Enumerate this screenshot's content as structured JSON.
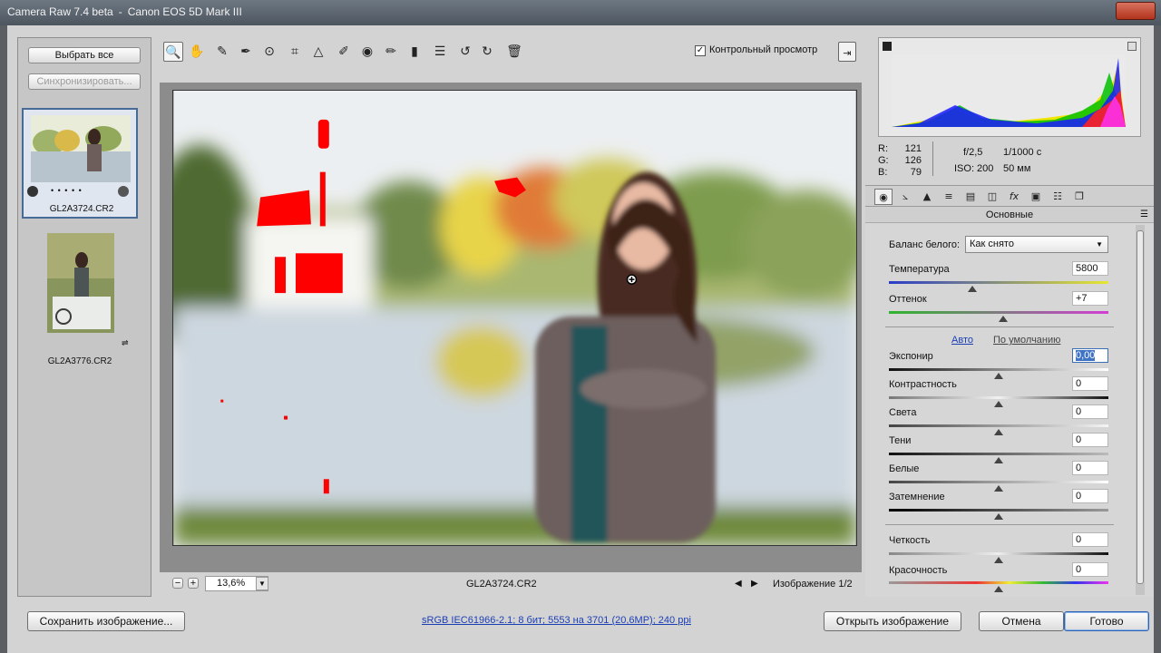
{
  "window": {
    "app": "Camera Raw 7.4 beta",
    "separator": "-",
    "camera": "Canon EOS 5D Mark III"
  },
  "filmstrip": {
    "select_all": "Выбрать все",
    "synchronize": "Синхронизировать...",
    "rating_dots": "• • • • •",
    "items": [
      {
        "name": "GL2A3724.CR2",
        "selected": true
      },
      {
        "name": "GL2A3776.CR2",
        "selected": false
      }
    ]
  },
  "toolbar": {
    "tools": [
      {
        "icon": "zoom-icon",
        "glyph": "🔍"
      },
      {
        "icon": "hand-icon",
        "glyph": "✋"
      },
      {
        "icon": "white-balance-icon",
        "glyph": "✎"
      },
      {
        "icon": "color-sampler-icon",
        "glyph": "✒"
      },
      {
        "icon": "target-adjust-icon",
        "glyph": "⊙"
      },
      {
        "icon": "crop-icon",
        "glyph": "⌗"
      },
      {
        "icon": "straighten-icon",
        "glyph": "△"
      },
      {
        "icon": "spot-removal-icon",
        "glyph": "✐"
      },
      {
        "icon": "red-eye-icon",
        "glyph": "◉"
      },
      {
        "icon": "adjustment-brush-icon",
        "glyph": "✏"
      },
      {
        "icon": "graduated-filter-icon",
        "glyph": "▮"
      },
      {
        "icon": "preferences-icon",
        "glyph": "☰"
      },
      {
        "icon": "rotate-left-icon",
        "glyph": "↺"
      },
      {
        "icon": "rotate-right-icon",
        "glyph": "↻"
      },
      {
        "icon": "trash-icon",
        "glyph": "🗑"
      }
    ],
    "preview_checked": "✓",
    "preview_label": "Контрольный просмотр",
    "fullscreen_icon": "fullscreen-icon"
  },
  "status": {
    "zoom": "13,6%",
    "filename": "GL2A3724.CR2",
    "image_counter": "Изображение 1/2"
  },
  "info": {
    "r_label": "R:",
    "r": "121",
    "g_label": "G:",
    "g": "126",
    "b_label": "B:",
    "b": "79",
    "aperture": "f/2,5",
    "shutter": "1/1000 с",
    "iso": "ISO: 200",
    "focal": "50 мм"
  },
  "panel": {
    "title": "Основные",
    "white_balance_label": "Баланс белого:",
    "white_balance_value": "Как снято",
    "auto": "Авто",
    "default": "По умолчанию",
    "sliders": [
      {
        "label": "Температура",
        "value": "5800",
        "level": 0.38
      },
      {
        "label": "Оттенок",
        "value": "+7",
        "level": 0.52
      },
      {
        "label": "Экспонир",
        "value": "0,00",
        "level": 0.5
      },
      {
        "label": "Контрастность",
        "value": "0",
        "level": 0.5
      },
      {
        "label": "Света",
        "value": "0",
        "level": 0.5
      },
      {
        "label": "Тени",
        "value": "0",
        "level": 0.5
      },
      {
        "label": "Белые",
        "value": "0",
        "level": 0.5
      },
      {
        "label": "Затемнение",
        "value": "0",
        "level": 0.5
      },
      {
        "label": "Четкость",
        "value": "0",
        "level": 0.5
      },
      {
        "label": "Красочность",
        "value": "0",
        "level": 0.5
      }
    ]
  },
  "footer": {
    "save": "Сохранить изображение...",
    "workflow_link": "sRGB IEC61966-2.1; 8 бит; 5553 на 3701 (20,6МР); 240 ppi",
    "open": "Открыть изображение",
    "cancel": "Отмена",
    "done": "Готово"
  },
  "colors": {
    "clipping": "#ff0000",
    "accent": "#3f74c4"
  }
}
